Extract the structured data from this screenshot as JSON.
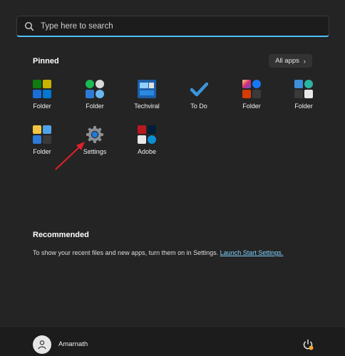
{
  "search": {
    "placeholder": "Type here to search"
  },
  "pinned": {
    "title": "Pinned",
    "all_apps_label": "All apps",
    "items": [
      {
        "label": "Folder",
        "icon": "folder-icon-xbox-grid"
      },
      {
        "label": "Folder",
        "icon": "folder-icon-spotify-grid"
      },
      {
        "label": "Techviral",
        "icon": "techviral-icon"
      },
      {
        "label": "To Do",
        "icon": "todo-check-icon"
      },
      {
        "label": "Folder",
        "icon": "folder-icon-instagram-grid"
      },
      {
        "label": "Folder",
        "icon": "folder-icon-edge-grid"
      },
      {
        "label": "Folder",
        "icon": "folder-icon-explorer-grid"
      },
      {
        "label": "Settings",
        "icon": "gear-icon"
      },
      {
        "label": "Adobe",
        "icon": "adobe-grid-icon"
      }
    ]
  },
  "recommended": {
    "title": "Recommended",
    "text": "To show your recent files and new apps, turn them on in Settings.",
    "link": "Launch Start Settings."
  },
  "user": {
    "name": "Amarnath"
  },
  "colors": {
    "accent": "#4cc2ff",
    "background": "#242424",
    "arrow": "#e0202a"
  }
}
